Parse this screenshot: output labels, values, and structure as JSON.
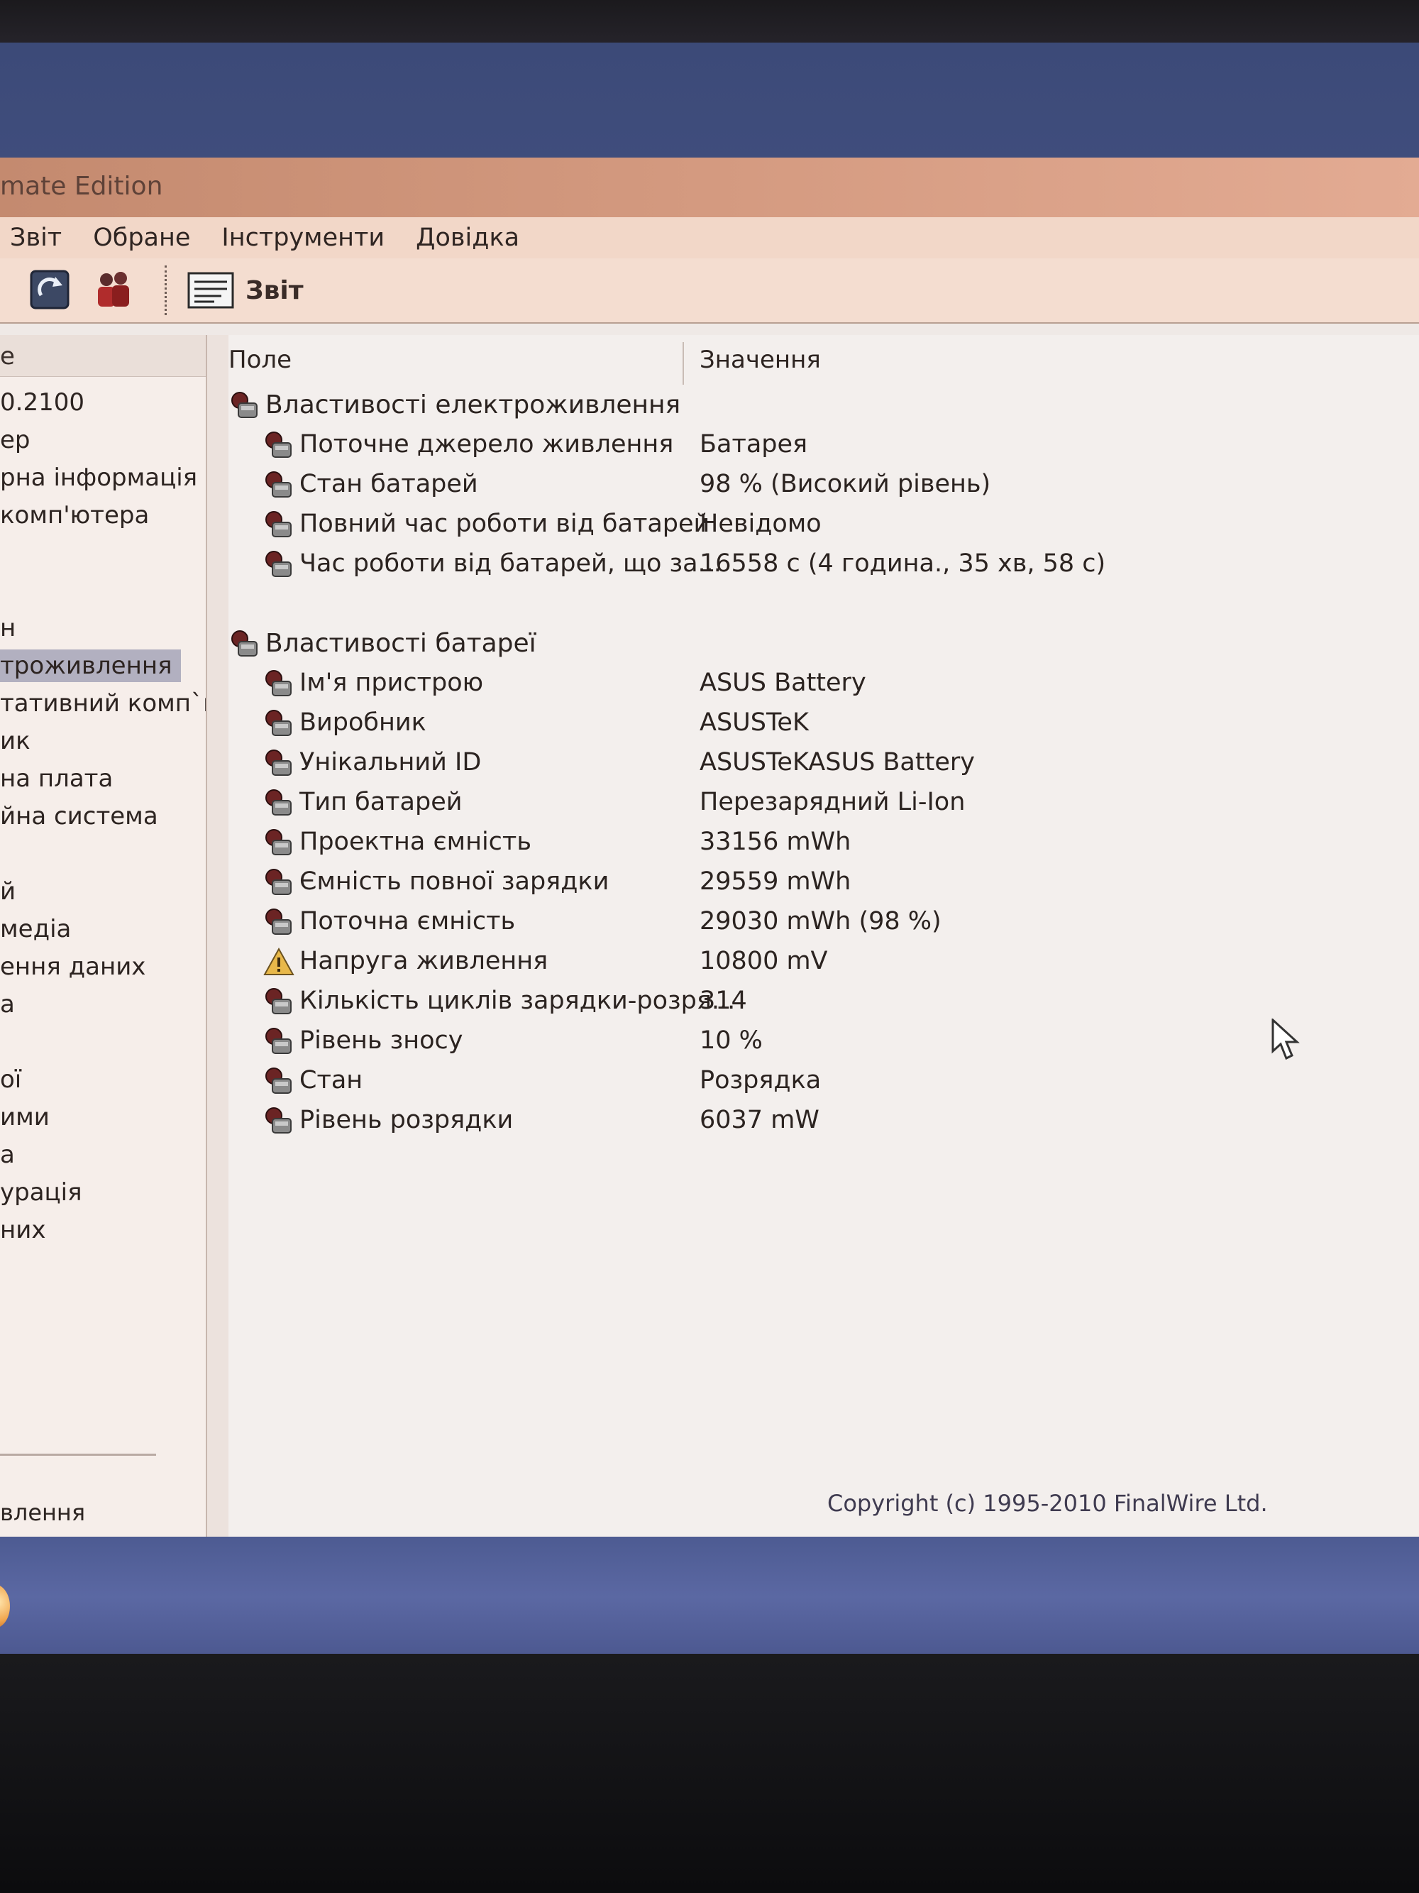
{
  "window": {
    "title": "mate Edition"
  },
  "menu": [
    "Звіт",
    "Обране",
    "Інструменти",
    "Довідка"
  ],
  "toolbar": {
    "report_label": "Звіт"
  },
  "left_pane": {
    "header": "е",
    "items": [
      "0.2100",
      "ер",
      "рна інформація",
      "комп'ютера",
      "",
      "",
      "н",
      "троживлення",
      "тативний комп`ю",
      "ик",
      "на плата",
      "йна система",
      "",
      "й",
      "медіа",
      "ення даних",
      "а",
      "",
      "ої",
      "ими",
      "а",
      "урація",
      "них"
    ],
    "selected_index": 7,
    "status_text": "влення"
  },
  "columns": {
    "field": "Поле",
    "value": "Значення"
  },
  "sections": [
    {
      "title": "Властивості електроживлення",
      "rows": [
        {
          "field": "Поточне джерело живлення",
          "value": "Батарея",
          "icon": "battery-icon"
        },
        {
          "field": "Стан батарей",
          "value": "98 % (Високий рівень)",
          "icon": "battery-icon"
        },
        {
          "field": "Повний час роботи від батарей",
          "value": "Невідомо",
          "icon": "battery-icon"
        },
        {
          "field": "Час роботи від батарей, що за...",
          "value": "16558 с (4 година., 35 хв, 58 с)",
          "icon": "battery-icon"
        }
      ]
    },
    {
      "title": "Властивості батареї",
      "rows": [
        {
          "field": "Ім'я пристрою",
          "value": "ASUS Battery",
          "icon": "battery-icon"
        },
        {
          "field": "Виробник",
          "value": "ASUSTeK",
          "icon": "battery-icon"
        },
        {
          "field": "Унікальний ID",
          "value": "ASUSTeKASUS Battery",
          "icon": "battery-icon"
        },
        {
          "field": "Тип батарей",
          "value": "Перезарядний Li-Ion",
          "icon": "battery-icon"
        },
        {
          "field": "Проектна ємність",
          "value": "33156 mWh",
          "icon": "battery-icon"
        },
        {
          "field": "Ємність повної зарядки",
          "value": "29559 mWh",
          "icon": "battery-icon"
        },
        {
          "field": "Поточна ємність",
          "value": "29030 mWh  (98 %)",
          "icon": "battery-icon"
        },
        {
          "field": "Напруга живлення",
          "value": "10800 mV",
          "icon": "warning-icon"
        },
        {
          "field": "Кількість циклів зарядки-розря...",
          "value": "314",
          "icon": "battery-icon"
        },
        {
          "field": "Рівень зносу",
          "value": "10 %",
          "icon": "battery-icon"
        },
        {
          "field": "Стан",
          "value": "Розрядка",
          "icon": "battery-icon"
        },
        {
          "field": "Рівень розрядки",
          "value": "6037 mW",
          "icon": "battery-icon"
        }
      ]
    }
  ],
  "copyright": "Copyright (c) 1995-2010 FinalWire Ltd.",
  "colors": {
    "titlebar": "#d49a80",
    "menubar": "#f2d7c8",
    "selection": "#b2b0c0",
    "taskbar": "#5b68a3"
  }
}
